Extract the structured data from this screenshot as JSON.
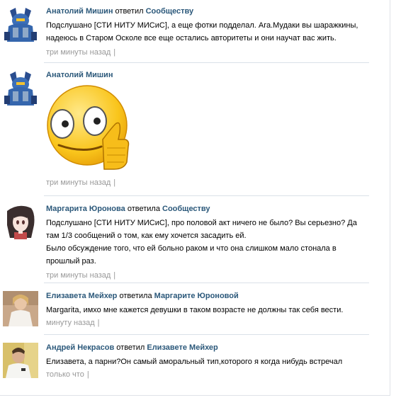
{
  "comments": [
    {
      "author": "Анатолий Мишин",
      "verb": "ответил",
      "target": "Сообществу",
      "text": "Подслушано [СТИ НИТУ МИСиС], а еще фотки подделал. Ага.Мудаки вы шаражкины, надеюсь в Старом Осколе все еще остались авторитеты и они научат вас жить.",
      "time": "три минуты назад",
      "separator": "|"
    },
    {
      "author": "Анатолий Мишин",
      "sticker": "thumbs-up-smiley",
      "time": "три минуты назад",
      "separator": "|"
    },
    {
      "author": "Маргарита Юронова",
      "verb": "ответила",
      "target": "Сообществу",
      "text": "Подслушано [СТИ НИТУ МИСиС], про половой акт ничего не было? Вы серьезно? Да там 1/3 сообщений о том, как ему хочется засадить ей.",
      "text2": "Было обсуждение того, что ей больно раком и что она слишком мало стонала в прошлый раз.",
      "time": "три минуты назад",
      "separator": "|"
    },
    {
      "author": "Елизавета Мейхер",
      "verb": "ответила",
      "target": "Маргарите Юроновой",
      "text": "Margarita, имхо мне кажется девушки в таком возрасте не должны так себя вести.",
      "time": "минуту назад",
      "separator": "|"
    },
    {
      "author": "Андрей Некрасов",
      "verb": "ответил",
      "target": "Елизавете Мейхер",
      "text": "Елизавета, а парни?Он самый аморальный тип,которого я когда нибудь встречал",
      "time": "только что",
      "separator": "|"
    }
  ]
}
